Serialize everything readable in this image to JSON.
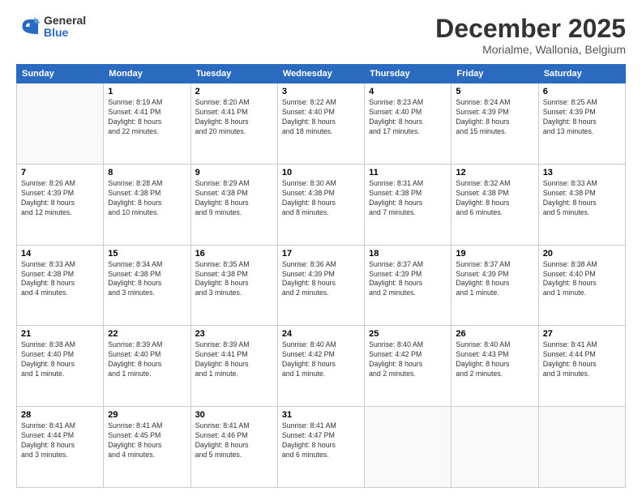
{
  "logo": {
    "general": "General",
    "blue": "Blue"
  },
  "header": {
    "month": "December 2025",
    "location": "Morialme, Wallonia, Belgium"
  },
  "weekdays": [
    "Sunday",
    "Monday",
    "Tuesday",
    "Wednesday",
    "Thursday",
    "Friday",
    "Saturday"
  ],
  "days": [
    {
      "num": "",
      "info": ""
    },
    {
      "num": "1",
      "info": "Sunrise: 8:19 AM\nSunset: 4:41 PM\nDaylight: 8 hours\nand 22 minutes."
    },
    {
      "num": "2",
      "info": "Sunrise: 8:20 AM\nSunset: 4:41 PM\nDaylight: 8 hours\nand 20 minutes."
    },
    {
      "num": "3",
      "info": "Sunrise: 8:22 AM\nSunset: 4:40 PM\nDaylight: 8 hours\nand 18 minutes."
    },
    {
      "num": "4",
      "info": "Sunrise: 8:23 AM\nSunset: 4:40 PM\nDaylight: 8 hours\nand 17 minutes."
    },
    {
      "num": "5",
      "info": "Sunrise: 8:24 AM\nSunset: 4:39 PM\nDaylight: 8 hours\nand 15 minutes."
    },
    {
      "num": "6",
      "info": "Sunrise: 8:25 AM\nSunset: 4:39 PM\nDaylight: 8 hours\nand 13 minutes."
    },
    {
      "num": "7",
      "info": "Sunrise: 8:26 AM\nSunset: 4:39 PM\nDaylight: 8 hours\nand 12 minutes."
    },
    {
      "num": "8",
      "info": "Sunrise: 8:28 AM\nSunset: 4:38 PM\nDaylight: 8 hours\nand 10 minutes."
    },
    {
      "num": "9",
      "info": "Sunrise: 8:29 AM\nSunset: 4:38 PM\nDaylight: 8 hours\nand 9 minutes."
    },
    {
      "num": "10",
      "info": "Sunrise: 8:30 AM\nSunset: 4:38 PM\nDaylight: 8 hours\nand 8 minutes."
    },
    {
      "num": "11",
      "info": "Sunrise: 8:31 AM\nSunset: 4:38 PM\nDaylight: 8 hours\nand 7 minutes."
    },
    {
      "num": "12",
      "info": "Sunrise: 8:32 AM\nSunset: 4:38 PM\nDaylight: 8 hours\nand 6 minutes."
    },
    {
      "num": "13",
      "info": "Sunrise: 8:33 AM\nSunset: 4:38 PM\nDaylight: 8 hours\nand 5 minutes."
    },
    {
      "num": "14",
      "info": "Sunrise: 8:33 AM\nSunset: 4:38 PM\nDaylight: 8 hours\nand 4 minutes."
    },
    {
      "num": "15",
      "info": "Sunrise: 8:34 AM\nSunset: 4:38 PM\nDaylight: 8 hours\nand 3 minutes."
    },
    {
      "num": "16",
      "info": "Sunrise: 8:35 AM\nSunset: 4:38 PM\nDaylight: 8 hours\nand 3 minutes."
    },
    {
      "num": "17",
      "info": "Sunrise: 8:36 AM\nSunset: 4:39 PM\nDaylight: 8 hours\nand 2 minutes."
    },
    {
      "num": "18",
      "info": "Sunrise: 8:37 AM\nSunset: 4:39 PM\nDaylight: 8 hours\nand 2 minutes."
    },
    {
      "num": "19",
      "info": "Sunrise: 8:37 AM\nSunset: 4:39 PM\nDaylight: 8 hours\nand 1 minute."
    },
    {
      "num": "20",
      "info": "Sunrise: 8:38 AM\nSunset: 4:40 PM\nDaylight: 8 hours\nand 1 minute."
    },
    {
      "num": "21",
      "info": "Sunrise: 8:38 AM\nSunset: 4:40 PM\nDaylight: 8 hours\nand 1 minute."
    },
    {
      "num": "22",
      "info": "Sunrise: 8:39 AM\nSunset: 4:40 PM\nDaylight: 8 hours\nand 1 minute."
    },
    {
      "num": "23",
      "info": "Sunrise: 8:39 AM\nSunset: 4:41 PM\nDaylight: 8 hours\nand 1 minute."
    },
    {
      "num": "24",
      "info": "Sunrise: 8:40 AM\nSunset: 4:42 PM\nDaylight: 8 hours\nand 1 minute."
    },
    {
      "num": "25",
      "info": "Sunrise: 8:40 AM\nSunset: 4:42 PM\nDaylight: 8 hours\nand 2 minutes."
    },
    {
      "num": "26",
      "info": "Sunrise: 8:40 AM\nSunset: 4:43 PM\nDaylight: 8 hours\nand 2 minutes."
    },
    {
      "num": "27",
      "info": "Sunrise: 8:41 AM\nSunset: 4:44 PM\nDaylight: 8 hours\nand 3 minutes."
    },
    {
      "num": "28",
      "info": "Sunrise: 8:41 AM\nSunset: 4:44 PM\nDaylight: 8 hours\nand 3 minutes."
    },
    {
      "num": "29",
      "info": "Sunrise: 8:41 AM\nSunset: 4:45 PM\nDaylight: 8 hours\nand 4 minutes."
    },
    {
      "num": "30",
      "info": "Sunrise: 8:41 AM\nSunset: 4:46 PM\nDaylight: 8 hours\nand 5 minutes."
    },
    {
      "num": "31",
      "info": "Sunrise: 8:41 AM\nSunset: 4:47 PM\nDaylight: 8 hours\nand 6 minutes."
    }
  ]
}
